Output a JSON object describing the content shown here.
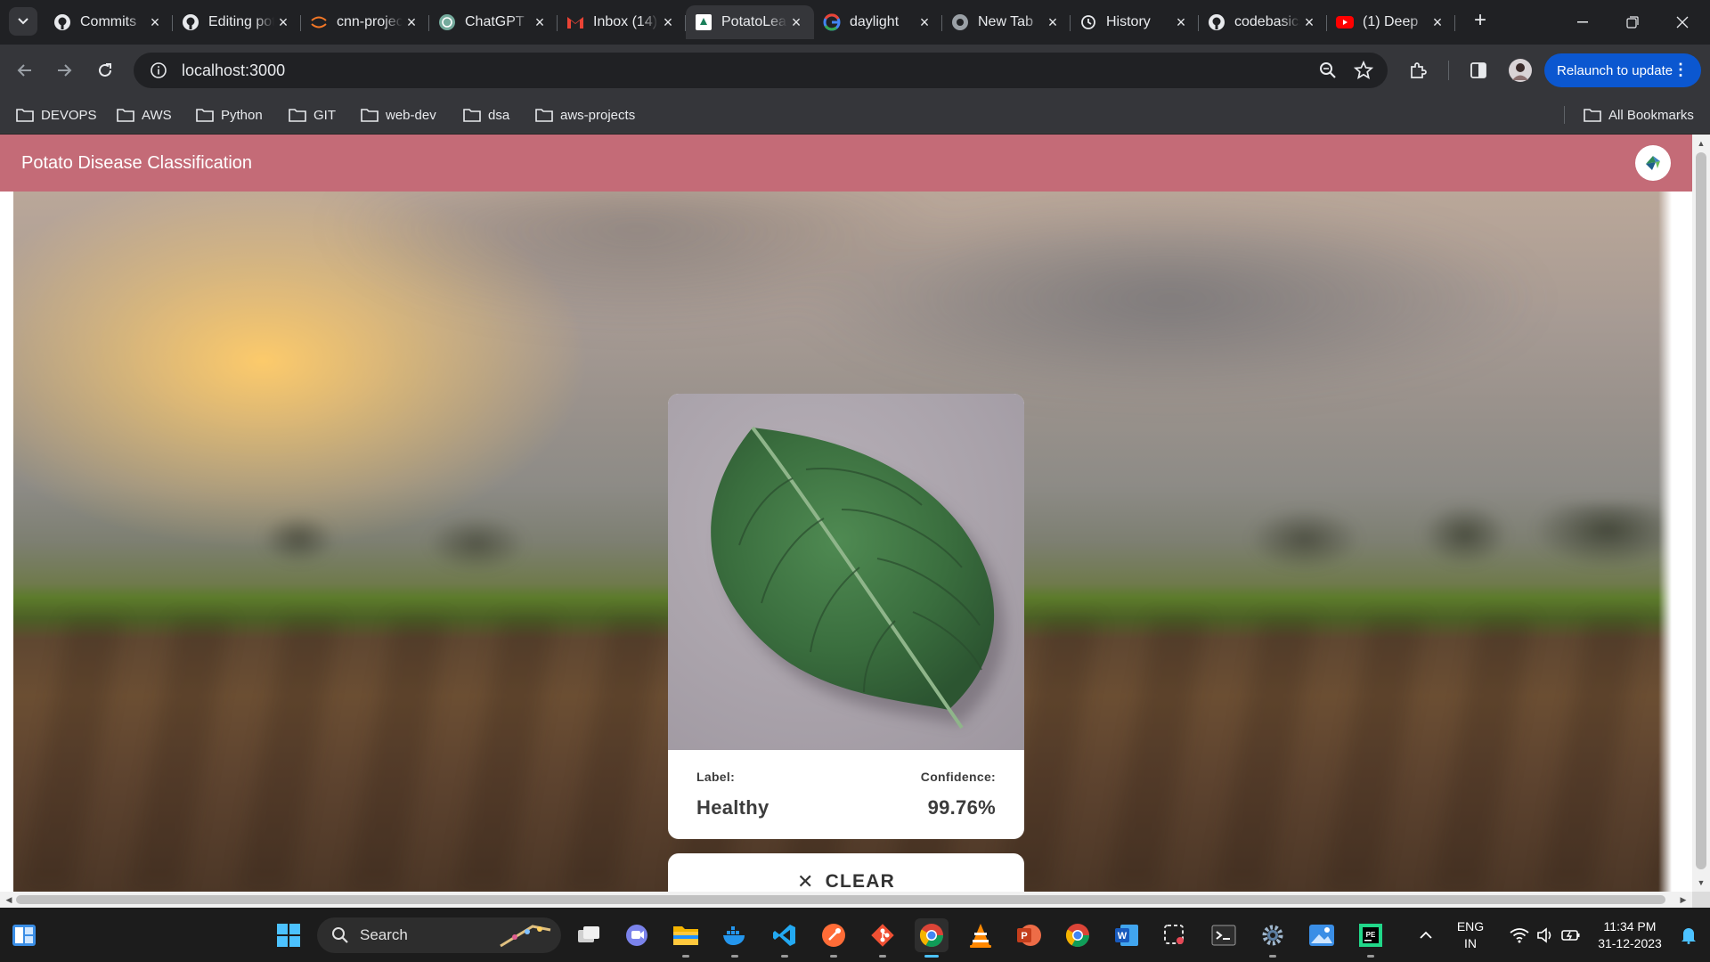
{
  "browser": {
    "tabs": [
      {
        "title": "Commits",
        "icon": "github-icon",
        "active": false
      },
      {
        "title": "Editing potato",
        "icon": "github-icon",
        "active": false
      },
      {
        "title": "cnn-project",
        "icon": "jupyter-icon",
        "active": false
      },
      {
        "title": "ChatGPT",
        "icon": "chatgpt-icon",
        "active": false
      },
      {
        "title": "Inbox (14)",
        "icon": "gmail-icon",
        "active": false
      },
      {
        "title": "PotatoLeaf",
        "icon": "potato-app-icon",
        "active": true
      },
      {
        "title": "daylight",
        "icon": "google-icon",
        "active": false
      },
      {
        "title": "New Tab",
        "icon": "chrome-icon",
        "active": false
      },
      {
        "title": "History",
        "icon": "history-icon",
        "active": false
      },
      {
        "title": "codebasics",
        "icon": "github-icon",
        "active": false
      },
      {
        "title": "(1) Deep",
        "icon": "youtube-icon",
        "active": false
      }
    ],
    "url": "localhost:3000",
    "relaunch_label": "Relaunch to update",
    "bookmarks": [
      "DEVOPS",
      "AWS",
      "Python",
      "GIT",
      "web-dev",
      "dsa",
      "aws-projects"
    ],
    "all_bookmarks_label": "All Bookmarks"
  },
  "app": {
    "title": "Potato Disease Classification",
    "result": {
      "label_caption": "Label:",
      "label_value": "Healthy",
      "confidence_caption": "Confidence:",
      "confidence_value": "99.76%"
    },
    "clear_label": "CLEAR"
  },
  "taskbar": {
    "search_placeholder": "Search",
    "language_line1": "ENG",
    "language_line2": "IN",
    "time": "11:34 PM",
    "date": "31-12-2023"
  },
  "colors": {
    "app_bar": "#c46b77",
    "browser_dark": "#202124",
    "toolbar": "#35363a",
    "relaunch_button": "#0b57d0",
    "active_taskbar_indicator": "#4cc2ff"
  }
}
